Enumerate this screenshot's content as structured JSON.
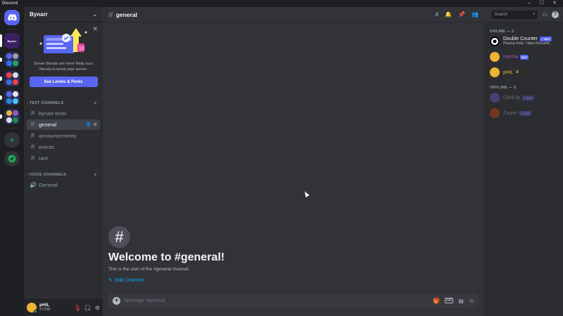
{
  "window": {
    "title": "Discord",
    "min": "–",
    "max": "☐",
    "close": "✕"
  },
  "server": {
    "name": "Bynarr",
    "active_label": "Bynarr",
    "boost": {
      "text": "Server Boosts are here! Rally your friends to boost your server.",
      "button": "See Levels & Perks",
      "badge_num": "10"
    }
  },
  "categories": {
    "text": "TEXT CHANNELS",
    "voice": "VOICE CHANNELS"
  },
  "text_channels": [
    "bynarr-tests",
    "general",
    "announcements",
    "events",
    "rant"
  ],
  "voice_channels": [
    "General"
  ],
  "user": {
    "name": "pHiL",
    "tag": "#7708"
  },
  "topbar": {
    "channel": "general",
    "search_placeholder": "Search"
  },
  "welcome": {
    "title": "Welcome to #general!",
    "subtitle": "This is the start of the #general channel.",
    "edit": "Edit Channel"
  },
  "composer": {
    "placeholder": "Message #general",
    "gif": "GIF"
  },
  "members": {
    "online_label": "ONLINE — 3",
    "offline_label": "OFFLINE — 2",
    "bot_badge": "BOT",
    "online": [
      {
        "name": "Double Counter",
        "activity": "Playing /help - https://dcounte...",
        "bot": true,
        "color": "#f2f3f5"
      },
      {
        "name": "Nertha",
        "activity": "",
        "bot": true,
        "color": "#9b59b6"
      },
      {
        "name": "pHiL",
        "activity": "",
        "bot": false,
        "color": "#f0b232"
      }
    ],
    "offline": [
      {
        "name": "ClickUp",
        "bot": true
      },
      {
        "name": "Zapier",
        "bot": true
      }
    ]
  },
  "colors": {
    "accent": "#5865f2",
    "online": "#23a55a",
    "link": "#00a8fc"
  }
}
